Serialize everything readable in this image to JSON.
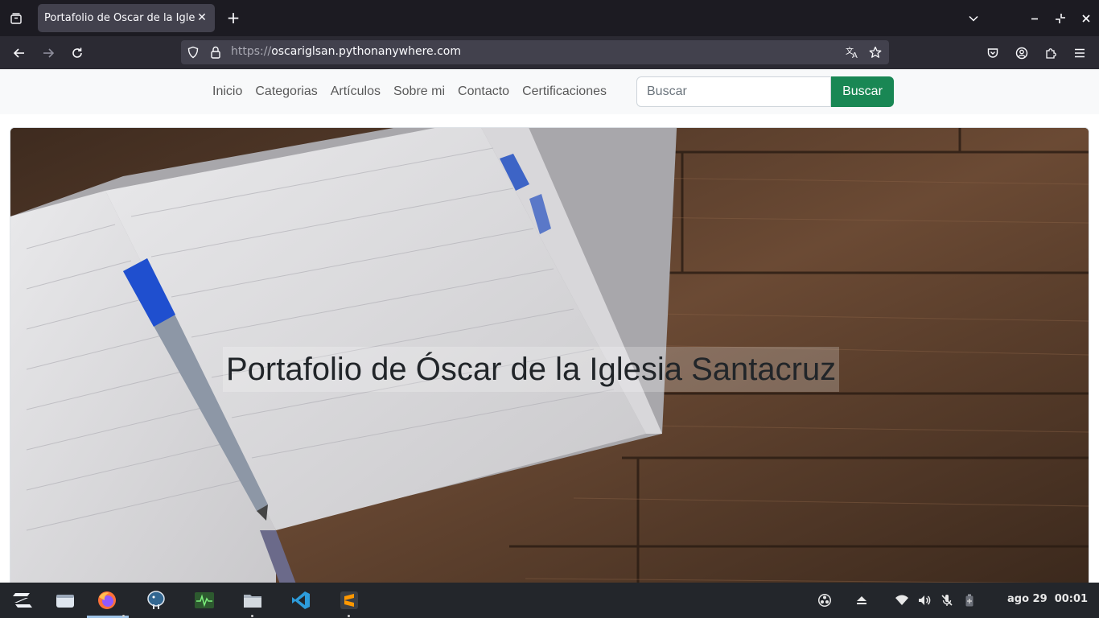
{
  "browser": {
    "tab": {
      "title": "Portafolio de Óscar de la Iglesia Santacruz"
    },
    "url": {
      "scheme": "https://",
      "host": "oscariglsan.pythonanywhere.com"
    }
  },
  "site": {
    "nav": [
      {
        "label": "Inicio"
      },
      {
        "label": "Categorias"
      },
      {
        "label": "Artículos"
      },
      {
        "label": "Sobre mi"
      },
      {
        "label": "Contacto"
      },
      {
        "label": "Certificaciones"
      }
    ],
    "search": {
      "placeholder": "Buscar",
      "button_label": "Buscar"
    },
    "hero": {
      "title": "Portafolio de Óscar de la Iglesia Santacruz"
    }
  },
  "taskbar": {
    "apps": [
      "zorin-menu-icon",
      "files-window-icon",
      "firefox-icon",
      "pgadmin-elephant-icon",
      "system-monitor-icon",
      "file-manager-icon",
      "vscode-icon",
      "sublime-text-icon"
    ],
    "clock": {
      "date": "ago 29",
      "time": "00:01"
    }
  },
  "colors": {
    "search_button": "#198754",
    "browser_chrome": "#1c1b22",
    "taskbar": "#23262b"
  }
}
